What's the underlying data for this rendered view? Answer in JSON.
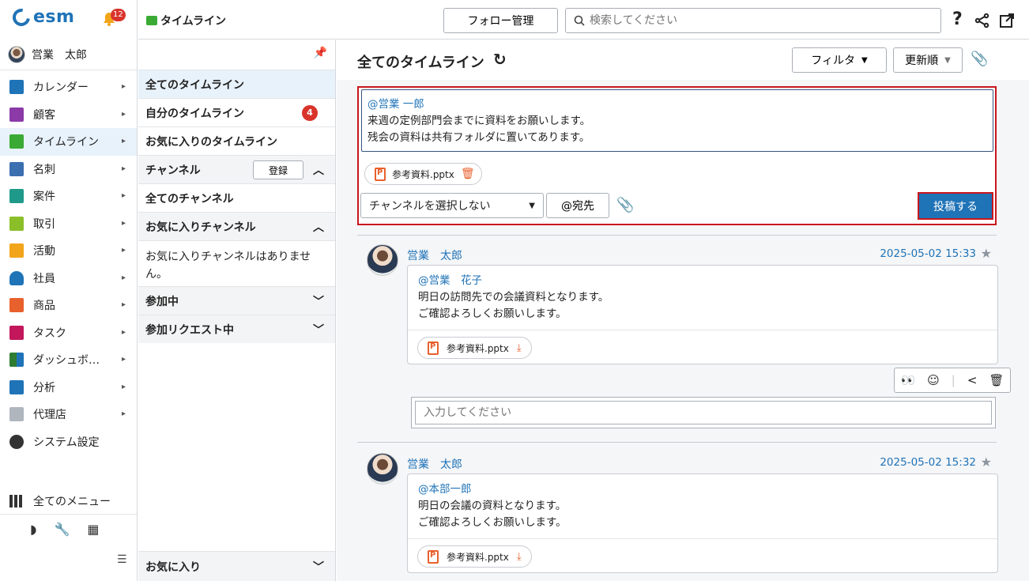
{
  "app": {
    "logo_text": "esm",
    "notification_count": "12",
    "user_name": "営業　太郎"
  },
  "nav": {
    "items": [
      {
        "label": "カレンダー",
        "color": "#1f73b7"
      },
      {
        "label": "顧客",
        "color": "#8b3aa8"
      },
      {
        "label": "タイムライン",
        "color": "#3aaa35"
      },
      {
        "label": "名刺",
        "color": "#3b6fb0"
      },
      {
        "label": "案件",
        "color": "#1f9a8a"
      },
      {
        "label": "取引",
        "color": "#8bbf2a"
      },
      {
        "label": "活動",
        "color": "#f2a51a"
      },
      {
        "label": "社員",
        "color": "#1f73b7"
      },
      {
        "label": "商品",
        "color": "#e8602c"
      },
      {
        "label": "タスク",
        "color": "#c2185b"
      },
      {
        "label": "ダッシュボ…",
        "color": "#2e7d32"
      },
      {
        "label": "分析",
        "color": "#1f73b7"
      },
      {
        "label": "代理店",
        "color": "#b0b6bd"
      },
      {
        "label": "システム設定",
        "color": "#333333"
      }
    ],
    "all_menu": "全てのメニュー"
  },
  "topbar": {
    "title": "タイムライン",
    "follow_button": "フォロー管理",
    "search_placeholder": "検索してください"
  },
  "mid": {
    "all_timeline": "全てのタイムライン",
    "my_timeline": "自分のタイムライン",
    "my_timeline_count": "4",
    "fav_timeline": "お気に入りのタイムライン",
    "channel_header": "チャンネル",
    "register_button": "登録",
    "all_channels": "全てのチャンネル",
    "fav_channels": "お気に入りチャンネル",
    "fav_channels_empty": "お気に入りチャンネルはありません。",
    "joined": "参加中",
    "join_requests": "参加リクエスト中",
    "favorites": "お気に入り"
  },
  "main": {
    "heading": "全てのタイムライン",
    "filter_button": "フィルタ",
    "sort_button": "更新順"
  },
  "composer": {
    "mention": "@営業 一郎",
    "line1": "来週の定例部門会までに資料をお願いします。",
    "line2": "残会の資料は共有フォルダに置いてあります。",
    "attachment": "参考資料.pptx",
    "channel_select": "チャンネルを選択しない",
    "to_button": "@宛先",
    "post_button": "投稿する"
  },
  "posts": [
    {
      "author": "営業　太郎",
      "date": "2025-05-02 15:33",
      "mention": "@営業　花子",
      "line1": "明日の訪問先での会議資料となります。",
      "line2": "ご確認よろしくお願いします。",
      "file": "参考資料.pptx",
      "comment_placeholder": "入力してください"
    },
    {
      "author": "営業　太郎",
      "date": "2025-05-02 15:32",
      "mention": "@本部一郎",
      "line1": "明日の会議の資料となります。",
      "line2": "ご確認よろしくお願いします。",
      "file": "参考資料.pptx"
    }
  ]
}
